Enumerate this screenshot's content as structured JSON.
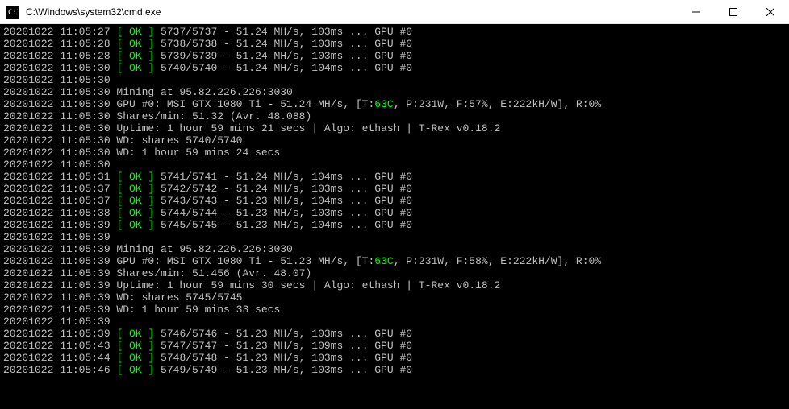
{
  "window": {
    "title": "C:\\Windows\\system32\\cmd.exe"
  },
  "lines": [
    {
      "ts": "20201022 11:05:27",
      "ok": true,
      "shares": "5737/5737",
      "hash": "51.24",
      "ms": "103",
      "gpu": "#0"
    },
    {
      "ts": "20201022 11:05:28",
      "ok": true,
      "shares": "5738/5738",
      "hash": "51.24",
      "ms": "103",
      "gpu": "#0"
    },
    {
      "ts": "20201022 11:05:28",
      "ok": true,
      "shares": "5739/5739",
      "hash": "51.24",
      "ms": "103",
      "gpu": "#0"
    },
    {
      "ts": "20201022 11:05:30",
      "ok": true,
      "shares": "5740/5740",
      "hash": "51.24",
      "ms": "104",
      "gpu": "#0"
    },
    {
      "ts": "20201022 11:05:30",
      "type": "blank"
    },
    {
      "ts": "20201022 11:05:30",
      "type": "text",
      "text": "Mining at 95.82.226.226:3030"
    },
    {
      "ts": "20201022 11:05:30",
      "type": "gpu",
      "model": "GPU #0: MSI GTX 1080 Ti",
      "hash": "51.24",
      "temp": "63C",
      "power": "P:231W",
      "fan": "F:57%",
      "eff": "E:222kH/W",
      "rej": "R:0%"
    },
    {
      "ts": "20201022 11:05:30",
      "type": "text",
      "text": "Shares/min: 51.32 (Avr. 48.088)"
    },
    {
      "ts": "20201022 11:05:30",
      "type": "text",
      "text": "Uptime: 1 hour 59 mins 21 secs | Algo: ethash | T-Rex v0.18.2"
    },
    {
      "ts": "20201022 11:05:30",
      "type": "text",
      "text": "WD: shares 5740/5740"
    },
    {
      "ts": "20201022 11:05:30",
      "type": "text",
      "text": "WD: 1 hour 59 mins 24 secs"
    },
    {
      "ts": "20201022 11:05:30",
      "type": "blank"
    },
    {
      "ts": "20201022 11:05:31",
      "ok": true,
      "shares": "5741/5741",
      "hash": "51.24",
      "ms": "104",
      "gpu": "#0"
    },
    {
      "ts": "20201022 11:05:37",
      "ok": true,
      "shares": "5742/5742",
      "hash": "51.24",
      "ms": "103",
      "gpu": "#0"
    },
    {
      "ts": "20201022 11:05:37",
      "ok": true,
      "shares": "5743/5743",
      "hash": "51.23",
      "ms": "104",
      "gpu": "#0"
    },
    {
      "ts": "20201022 11:05:38",
      "ok": true,
      "shares": "5744/5744",
      "hash": "51.23",
      "ms": "103",
      "gpu": "#0"
    },
    {
      "ts": "20201022 11:05:39",
      "ok": true,
      "shares": "5745/5745",
      "hash": "51.23",
      "ms": "104",
      "gpu": "#0"
    },
    {
      "ts": "20201022 11:05:39",
      "type": "blank"
    },
    {
      "ts": "20201022 11:05:39",
      "type": "text",
      "text": "Mining at 95.82.226.226:3030"
    },
    {
      "ts": "20201022 11:05:39",
      "type": "gpu",
      "model": "GPU #0: MSI GTX 1080 Ti",
      "hash": "51.23",
      "temp": "63C",
      "power": "P:231W",
      "fan": "F:58%",
      "eff": "E:222kH/W",
      "rej": "R:0%"
    },
    {
      "ts": "20201022 11:05:39",
      "type": "text",
      "text": "Shares/min: 51.456 (Avr. 48.07)"
    },
    {
      "ts": "20201022 11:05:39",
      "type": "text",
      "text": "Uptime: 1 hour 59 mins 30 secs | Algo: ethash | T-Rex v0.18.2"
    },
    {
      "ts": "20201022 11:05:39",
      "type": "text",
      "text": "WD: shares 5745/5745"
    },
    {
      "ts": "20201022 11:05:39",
      "type": "text",
      "text": "WD: 1 hour 59 mins 33 secs"
    },
    {
      "ts": "20201022 11:05:39",
      "type": "blank"
    },
    {
      "ts": "20201022 11:05:39",
      "ok": true,
      "shares": "5746/5746",
      "hash": "51.23",
      "ms": "103",
      "gpu": "#0"
    },
    {
      "ts": "20201022 11:05:43",
      "ok": true,
      "shares": "5747/5747",
      "hash": "51.23",
      "ms": "109",
      "gpu": "#0"
    },
    {
      "ts": "20201022 11:05:44",
      "ok": true,
      "shares": "5748/5748",
      "hash": "51.23",
      "ms": "103",
      "gpu": "#0"
    },
    {
      "ts": "20201022 11:05:46",
      "ok": true,
      "shares": "5749/5749",
      "hash": "51.23",
      "ms": "103",
      "gpu": "#0"
    }
  ],
  "ok_label": "OK"
}
